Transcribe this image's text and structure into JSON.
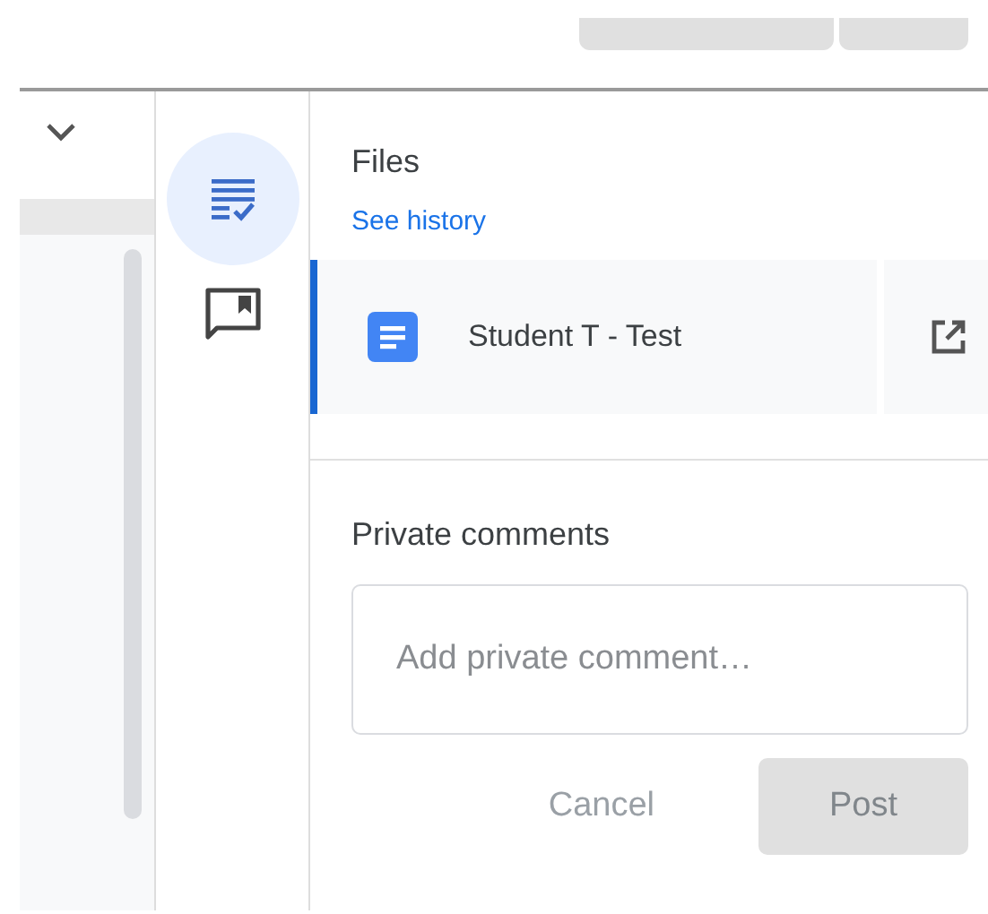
{
  "rail": [
    {
      "kind": "assignment",
      "selected": true
    },
    {
      "kind": "comment",
      "selected": false
    }
  ],
  "files": {
    "title": "Files",
    "history_link": "See history",
    "items": [
      {
        "name": "Student T - Test",
        "selected": true
      }
    ]
  },
  "private_comments": {
    "title": "Private comments",
    "placeholder": "Add private comment…",
    "buttons": [
      {
        "label": "Cancel",
        "kind": "text",
        "disabled": true
      },
      {
        "label": "Post",
        "kind": "filled",
        "disabled": true
      }
    ]
  }
}
